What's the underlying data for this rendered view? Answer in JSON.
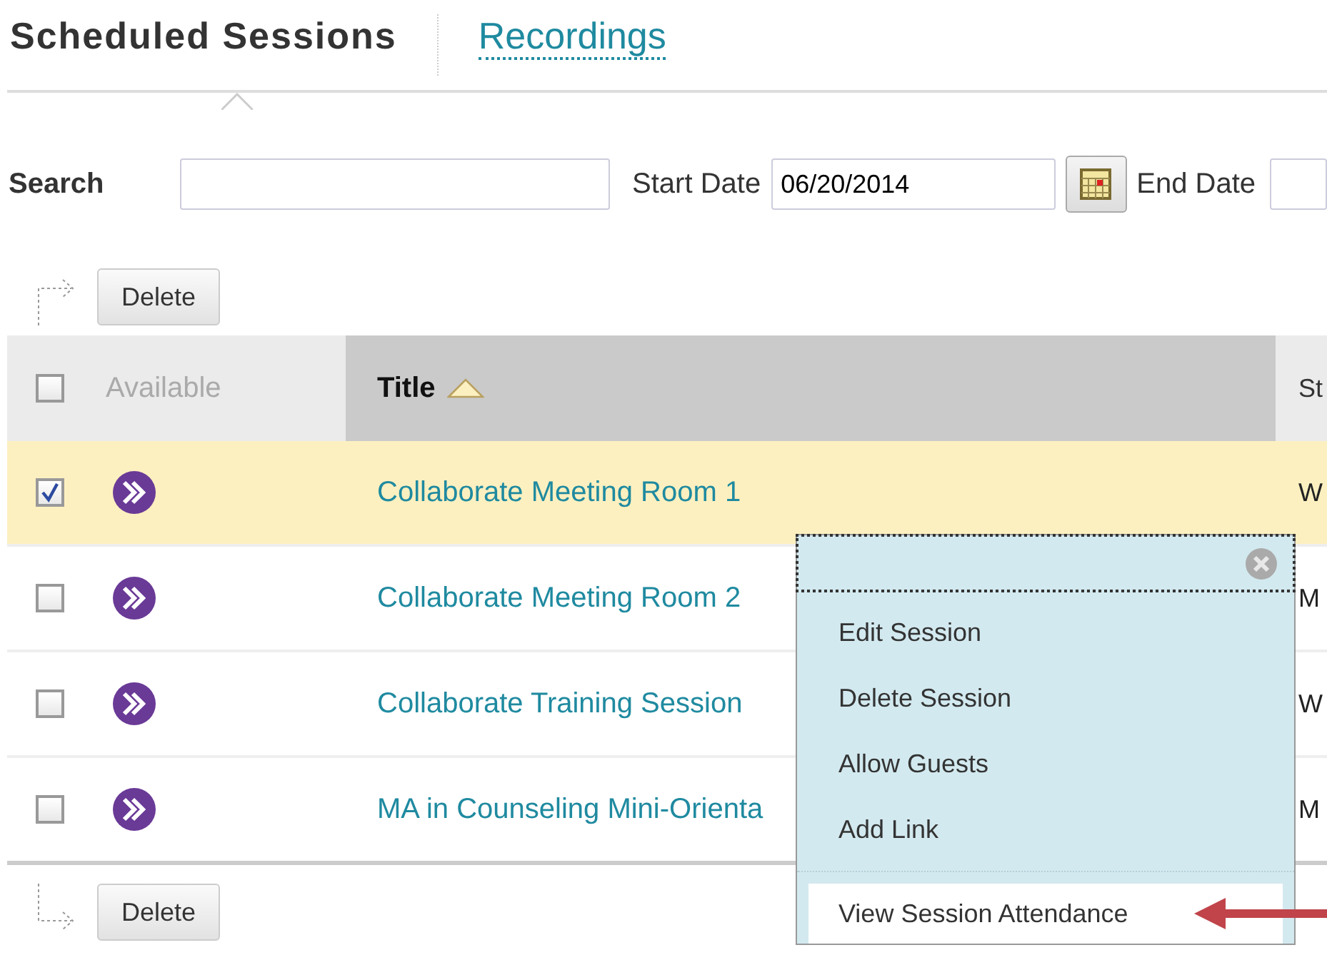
{
  "tabs": [
    {
      "label": "Scheduled Sessions",
      "selected": true
    },
    {
      "label": "Recordings",
      "selected": false
    }
  ],
  "filters": {
    "search_label": "Search",
    "start_date_label": "Start Date",
    "start_date": "06/20/2014",
    "end_date_label": "End Date"
  },
  "top_actions": [
    "Delete"
  ],
  "table": {
    "select_all_checked": false,
    "columns": [
      {
        "label": "Available",
        "sorted": false
      },
      {
        "label": "Title",
        "sorted": true
      },
      {
        "label": "St",
        "sorted": false
      }
    ],
    "rows": [
      {
        "checked": true,
        "title": "Collaborate Meeting Room 1",
        "column_3": "W"
      },
      {
        "checked": false,
        "title": "Collaborate Meeting Room 2",
        "column_3": "M"
      },
      {
        "checked": false,
        "title": "Collaborate Training Session",
        "column_3": "W"
      },
      {
        "checked": false,
        "title": "MA in Counseling Mini-Orienta",
        "column_3": "M"
      }
    ]
  },
  "bottom_actions": [
    "Delete"
  ],
  "context_menu": {
    "groups": [
      [
        {
          "label": "Edit Session",
          "selected": false
        },
        {
          "label": "Delete Session",
          "selected": false
        },
        {
          "label": "Allow Guests",
          "selected": false
        },
        {
          "label": "Add Link",
          "selected": false
        }
      ],
      [
        {
          "label": "View Session Attendance",
          "selected": true
        }
      ]
    ]
  }
}
